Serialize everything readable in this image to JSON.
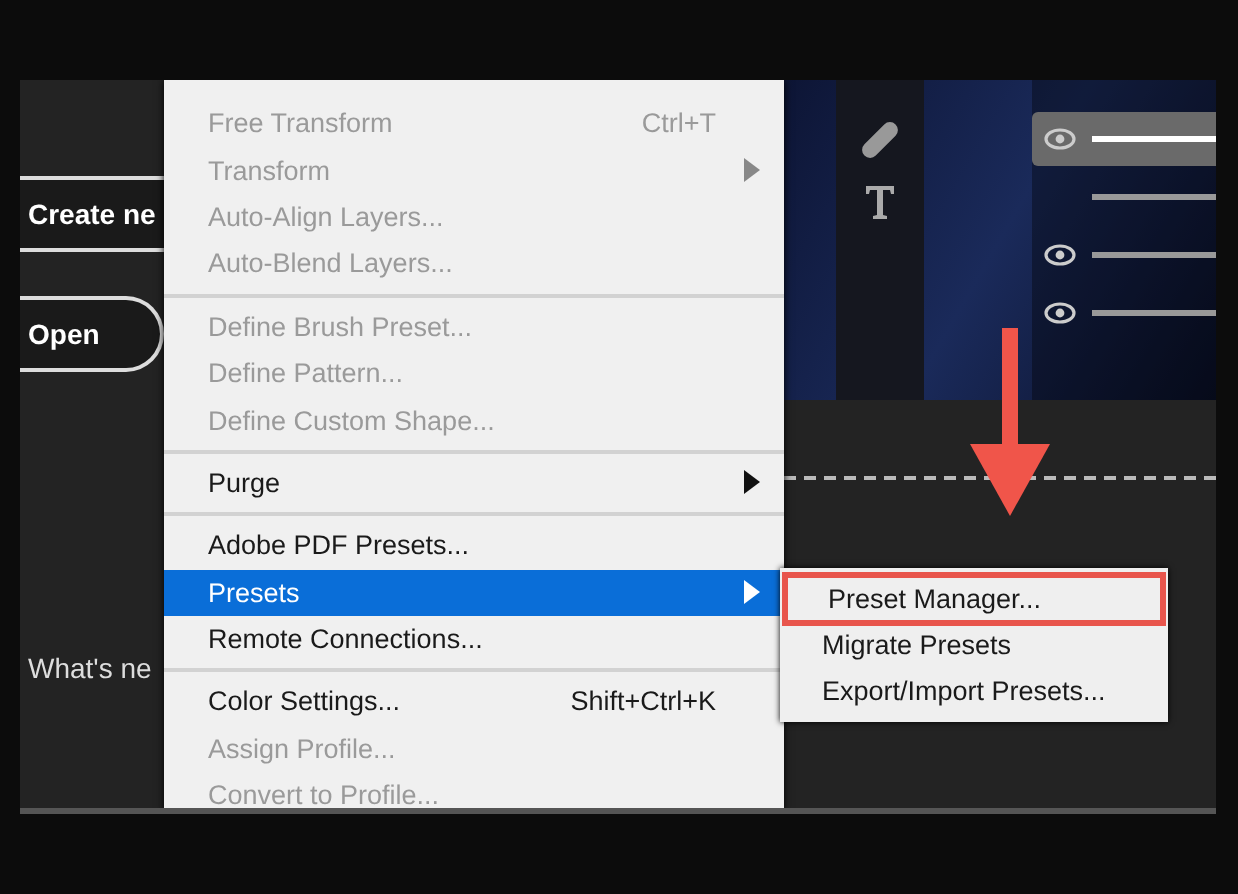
{
  "start_panel": {
    "buttons": [
      {
        "label": "Create ne",
        "kind": "square"
      },
      {
        "label": "Open",
        "kind": "pill"
      }
    ],
    "whats_new": "What's ne"
  },
  "layers": [
    {
      "visible": true,
      "selected": true
    },
    {
      "visible": false,
      "selected": false
    },
    {
      "visible": true,
      "selected": false
    },
    {
      "visible": true,
      "selected": false
    }
  ],
  "menu": {
    "items": [
      {
        "kind": "item",
        "label": "Free Transform",
        "shortcut": "Ctrl+T",
        "disabled": true,
        "submenu": false,
        "selected": false
      },
      {
        "kind": "item",
        "label": "Transform",
        "disabled": true,
        "submenu": true,
        "selected": false
      },
      {
        "kind": "item",
        "label": "Auto-Align Layers...",
        "disabled": true,
        "submenu": false,
        "selected": false
      },
      {
        "kind": "item",
        "label": "Auto-Blend Layers...",
        "disabled": true,
        "submenu": false,
        "selected": false
      },
      {
        "kind": "separator"
      },
      {
        "kind": "item",
        "label": "Define Brush Preset...",
        "disabled": true,
        "submenu": false,
        "selected": false
      },
      {
        "kind": "item",
        "label": "Define Pattern...",
        "disabled": true,
        "submenu": false,
        "selected": false
      },
      {
        "kind": "item",
        "label": "Define Custom Shape...",
        "disabled": true,
        "submenu": false,
        "selected": false
      },
      {
        "kind": "separator"
      },
      {
        "kind": "item",
        "label": "Purge",
        "disabled": false,
        "submenu": true,
        "selected": false
      },
      {
        "kind": "separator"
      },
      {
        "kind": "item",
        "label": "Adobe PDF Presets...",
        "disabled": false,
        "submenu": false,
        "selected": false
      },
      {
        "kind": "item",
        "label": "Presets",
        "disabled": false,
        "submenu": true,
        "selected": true
      },
      {
        "kind": "item",
        "label": "Remote Connections...",
        "disabled": false,
        "submenu": false,
        "selected": false
      },
      {
        "kind": "separator"
      },
      {
        "kind": "item",
        "label": "Color Settings...",
        "shortcut": "Shift+Ctrl+K",
        "disabled": false,
        "submenu": false,
        "selected": false
      },
      {
        "kind": "item",
        "label": "Assign Profile...",
        "disabled": true,
        "submenu": false,
        "selected": false
      },
      {
        "kind": "item",
        "label": "Convert to Profile...",
        "disabled": true,
        "submenu": false,
        "selected": false
      }
    ]
  },
  "submenu": {
    "items": [
      {
        "label": "Preset Manager...",
        "highlighted": true
      },
      {
        "label": "Migrate Presets",
        "highlighted": false
      },
      {
        "label": "Export/Import Presets...",
        "highlighted": false
      }
    ]
  }
}
